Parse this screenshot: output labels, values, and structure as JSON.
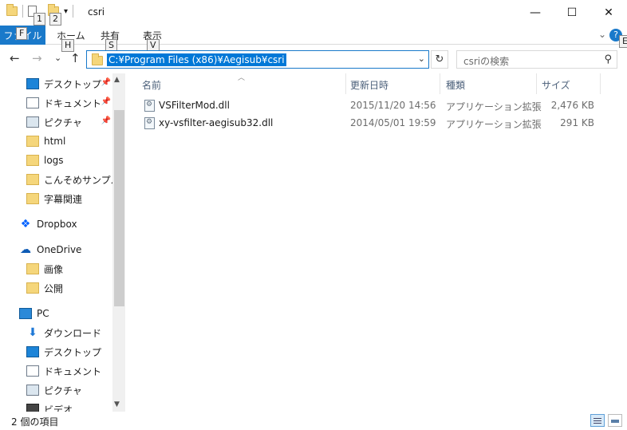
{
  "window": {
    "title": "csri",
    "qat_keytips": [
      "1",
      "2"
    ],
    "minimize": "—",
    "maximize": "☐",
    "close": "✕"
  },
  "ribbon": {
    "file_tab": "ファイル",
    "file_keytip": "F",
    "tabs": [
      {
        "label": "ホーム",
        "keytip": "H"
      },
      {
        "label": "共有",
        "keytip": "S"
      },
      {
        "label": "表示",
        "keytip": "V"
      }
    ],
    "help": "?",
    "help_keytip": "E"
  },
  "nav": {
    "back": "←",
    "forward": "→",
    "recent": "⌄",
    "up": "↑",
    "address": "C:¥Program Files (x86)¥Aegisub¥csri",
    "search_placeholder": "csriの検索"
  },
  "sidebar": {
    "items": [
      {
        "label": "デスクトップ",
        "icon": "desktop-icon",
        "pinned": true
      },
      {
        "label": "ドキュメント",
        "icon": "documents-icon",
        "pinned": true
      },
      {
        "label": "ピクチャ",
        "icon": "pictures-icon",
        "pinned": true
      },
      {
        "label": "html",
        "icon": "folder-icon",
        "pinned": false
      },
      {
        "label": "logs",
        "icon": "folder-icon",
        "pinned": false
      },
      {
        "label": "こんそめサンプル",
        "icon": "folder-icon",
        "pinned": false
      },
      {
        "label": "字幕関連",
        "icon": "folder-icon",
        "pinned": false
      },
      {
        "label": "Dropbox",
        "icon": "dropbox-icon",
        "pinned": false
      },
      {
        "label": "OneDrive",
        "icon": "onedrive-icon",
        "pinned": false
      },
      {
        "label": "画像",
        "icon": "folder-icon",
        "pinned": false
      },
      {
        "label": "公開",
        "icon": "folder-icon",
        "pinned": false
      },
      {
        "label": "PC",
        "icon": "pc-icon",
        "pinned": false
      },
      {
        "label": "ダウンロード",
        "icon": "downloads-icon",
        "pinned": false
      },
      {
        "label": "デスクトップ",
        "icon": "desktop-icon",
        "pinned": false
      },
      {
        "label": "ドキュメント",
        "icon": "documents-icon",
        "pinned": false
      },
      {
        "label": "ピクチャ",
        "icon": "pictures-icon",
        "pinned": false
      },
      {
        "label": "ビデオ",
        "icon": "videos-icon",
        "pinned": false
      }
    ]
  },
  "list": {
    "columns": {
      "name": "名前",
      "date": "更新日時",
      "type": "種類",
      "size": "サイズ"
    },
    "files": [
      {
        "name": "VSFilterMod.dll",
        "date": "2015/11/20 14:56",
        "type": "アプリケーション拡張",
        "size": "2,476 KB"
      },
      {
        "name": "xy-vsfilter-aegisub32.dll",
        "date": "2014/05/01 19:59",
        "type": "アプリケーション拡張",
        "size": "291 KB"
      }
    ]
  },
  "status": {
    "text": "2 個の項目"
  },
  "colors": {
    "accent": "#1979ca",
    "selection": "#0078d7"
  }
}
